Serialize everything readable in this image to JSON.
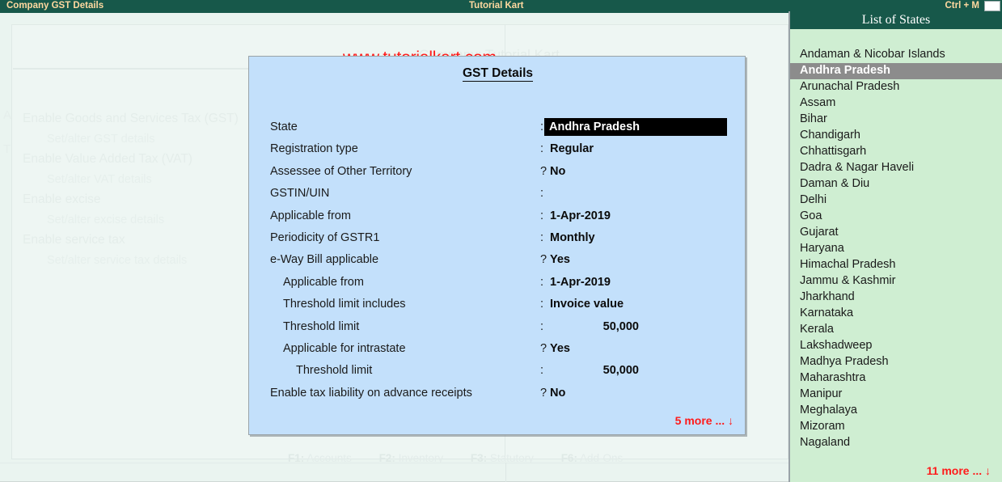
{
  "titlebar": {
    "left": "Company GST Details",
    "center": "Tutorial Kart",
    "right": "Ctrl + M"
  },
  "background": {
    "company_ghost": "Company: Tutorial Kart",
    "watermark": "www.tutorialkart.com",
    "side_letters": [
      "A",
      "T"
    ],
    "options": [
      {
        "main": "Enable Goods and Services Tax (GST)",
        "sub": "Set/alter GST details"
      },
      {
        "main": "Enable Value Added Tax (VAT)",
        "sub": "Set/alter VAT details"
      },
      {
        "main": "Enable excise",
        "sub": "Set/alter excise details"
      },
      {
        "main": "Enable service tax",
        "sub": "Set/alter service tax details"
      }
    ],
    "function_keys": [
      {
        "key": "F1:",
        "label": "Accounts"
      },
      {
        "key": "F2:",
        "label": "Inventory"
      },
      {
        "key": "F3:",
        "label": "Statutory"
      },
      {
        "key": "F6:",
        "label": "Add-Ons"
      }
    ]
  },
  "modal": {
    "title": "GST Details",
    "more": "5 more ...",
    "arrow": "↓",
    "fields": [
      {
        "label": "State",
        "sep": ":",
        "value": "Andhra Pradesh",
        "indent": 0,
        "highlight": true
      },
      {
        "label": "Registration type",
        "sep": ":",
        "value": "Regular",
        "indent": 0
      },
      {
        "label": "Assessee of Other Territory",
        "sep": "?",
        "value": "No",
        "indent": 0
      },
      {
        "label": "GSTIN/UIN",
        "sep": ":",
        "value": "",
        "indent": 0
      },
      {
        "label": "Applicable from",
        "sep": ":",
        "value": "1-Apr-2019",
        "indent": 0
      },
      {
        "label": "Periodicity of GSTR1",
        "sep": ":",
        "value": "Monthly",
        "indent": 0
      },
      {
        "label": "e-Way Bill applicable",
        "sep": "?",
        "value": "Yes",
        "indent": 0
      },
      {
        "label": "Applicable from",
        "sep": ":",
        "value": "1-Apr-2019",
        "indent": 1
      },
      {
        "label": "Threshold limit includes",
        "sep": ":",
        "value": "Invoice value",
        "indent": 1
      },
      {
        "label": "Threshold limit",
        "sep": ":",
        "value": "50,000",
        "indent": 1,
        "numeric": true
      },
      {
        "label": "Applicable for intrastate",
        "sep": "?",
        "value": "Yes",
        "indent": 1
      },
      {
        "label": "Threshold limit",
        "sep": ":",
        "value": "50,000",
        "indent": 2,
        "numeric": true
      },
      {
        "label": "Enable tax liability on advance receipts",
        "sep": "?",
        "value": "No",
        "indent": 0
      }
    ]
  },
  "states_panel": {
    "header": "List of States",
    "more": "11 more ...",
    "arrow": "↓",
    "selected": "Andhra Pradesh",
    "items": [
      "Andaman & Nicobar Islands",
      "Andhra Pradesh",
      "Arunachal Pradesh",
      "Assam",
      "Bihar",
      "Chandigarh",
      "Chhattisgarh",
      "Dadra & Nagar Haveli",
      "Daman & Diu",
      "Delhi",
      "Goa",
      "Gujarat",
      "Haryana",
      "Himachal Pradesh",
      "Jammu & Kashmir",
      "Jharkhand",
      "Karnataka",
      "Kerala",
      "Lakshadweep",
      "Madhya Pradesh",
      "Maharashtra",
      "Manipur",
      "Meghalaya",
      "Mizoram",
      "Nagaland"
    ]
  },
  "colors": {
    "title_bar": "#17584a",
    "title_text": "#ffd9a0",
    "modal_bg": "#c3e0fb",
    "states_bg": "#cfeed2",
    "selection": "#8c8c8c",
    "accent_red": "#ff1a1a",
    "workspace": "#eaf4f0"
  }
}
